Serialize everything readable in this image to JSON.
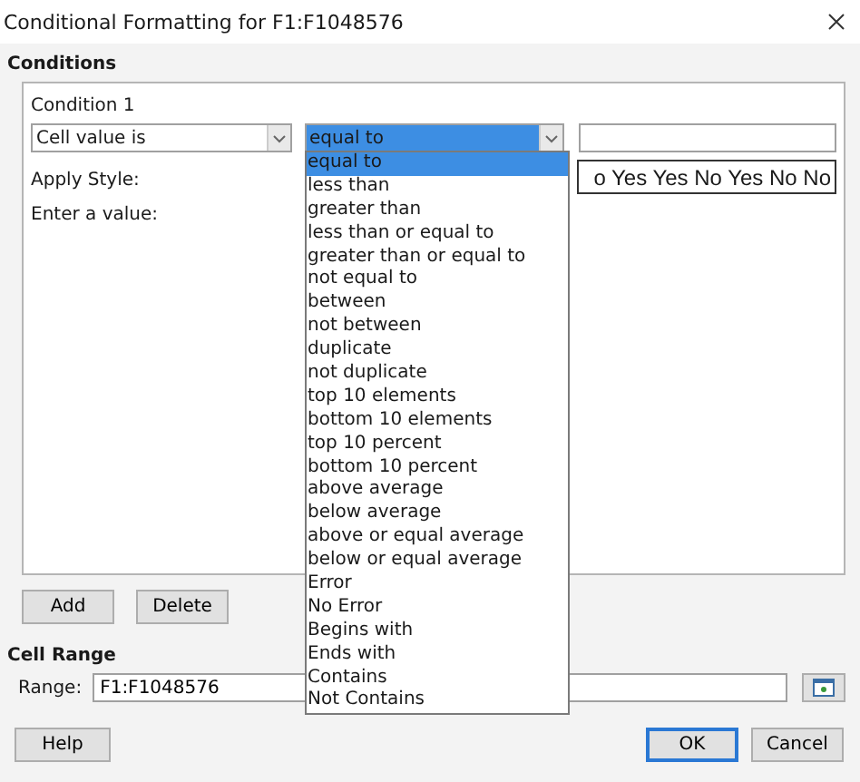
{
  "window": {
    "title": "Conditional Formatting for F1:F1048576"
  },
  "conditions": {
    "heading": "Conditions",
    "items": [
      {
        "title": "Condition 1",
        "type_combo": "Cell value is",
        "operator_combo": "equal to",
        "apply_style_label": "Apply Style:",
        "enter_value_label": "Enter a value:",
        "style_preview": "o Yes Yes No Yes No No"
      }
    ]
  },
  "operator_options": [
    {
      "label": "equal to",
      "selected": true
    },
    {
      "label": "less than",
      "selected": false
    },
    {
      "label": "greater than",
      "selected": false
    },
    {
      "label": "less than or equal to",
      "selected": false
    },
    {
      "label": "greater than or equal to",
      "selected": false
    },
    {
      "label": "not equal to",
      "selected": false
    },
    {
      "label": "between",
      "selected": false
    },
    {
      "label": "not between",
      "selected": false
    },
    {
      "label": "duplicate",
      "selected": false
    },
    {
      "label": "not duplicate",
      "selected": false
    },
    {
      "label": "top 10 elements",
      "selected": false
    },
    {
      "label": "bottom 10 elements",
      "selected": false
    },
    {
      "label": "top 10 percent",
      "selected": false
    },
    {
      "label": "bottom 10 percent",
      "selected": false
    },
    {
      "label": "above average",
      "selected": false
    },
    {
      "label": "below average",
      "selected": false
    },
    {
      "label": "above or equal average",
      "selected": false
    },
    {
      "label": "below or equal average",
      "selected": false
    },
    {
      "label": "Error",
      "selected": false
    },
    {
      "label": "No Error",
      "selected": false
    },
    {
      "label": "Begins with",
      "selected": false
    },
    {
      "label": "Ends with",
      "selected": false
    },
    {
      "label": "Contains",
      "selected": false
    },
    {
      "label": "Not Contains",
      "selected": false
    }
  ],
  "condition_buttons": [
    "Add",
    "Delete"
  ],
  "cell_range": {
    "heading": "Cell Range",
    "label": "Range:",
    "value": "F1:F1048576"
  },
  "footer_buttons": [
    {
      "label": "Help",
      "kind": "left",
      "default": false
    },
    {
      "label": "OK",
      "kind": "right",
      "default": true
    },
    {
      "label": "Cancel",
      "kind": "right",
      "default": false
    }
  ]
}
